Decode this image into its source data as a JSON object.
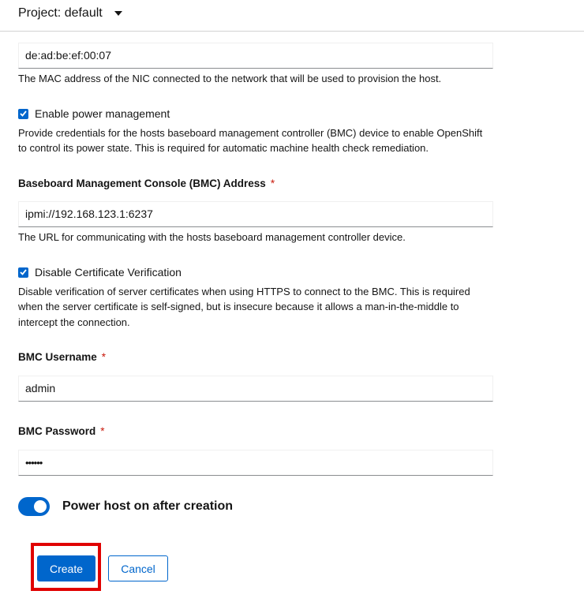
{
  "header": {
    "project_label": "Project: default"
  },
  "boot_mac": {
    "value": "de:ad:be:ef:00:07",
    "helper": "The MAC address of the NIC connected to the network that will be used to provision the host."
  },
  "power_management": {
    "checked": true,
    "label": "Enable power management",
    "helper_line1": "Provide credentials for the hosts baseboard management controller (BMC) device to enable OpenShift",
    "helper_line2": "to control its power state. This is required for automatic machine health check remediation."
  },
  "bmc_address": {
    "label": "Baseboard Management Console (BMC) Address",
    "required_mark": "*",
    "value": "ipmi://192.168.123.1:6237",
    "helper": "The URL for communicating with the hosts baseboard management controller device."
  },
  "disable_cert": {
    "checked": true,
    "label": "Disable Certificate Verification",
    "helper_line1": "Disable verification of server certificates when using HTTPS to connect to the BMC. This is required",
    "helper_line2": "when the server certificate is self-signed, but is insecure because it allows a man-in-the-middle to",
    "helper_line3": "intercept the connection."
  },
  "bmc_username": {
    "label": "BMC Username",
    "required_mark": "*",
    "value": "admin"
  },
  "bmc_password": {
    "label": "BMC Password",
    "required_mark": "*",
    "masked_value": "••••••"
  },
  "power_on_toggle": {
    "on": true,
    "label": "Power host on after creation"
  },
  "actions": {
    "create_label": "Create",
    "cancel_label": "Cancel"
  },
  "colors": {
    "primary": "#0066cc",
    "required": "#c9190b",
    "highlight": "#e00000"
  }
}
